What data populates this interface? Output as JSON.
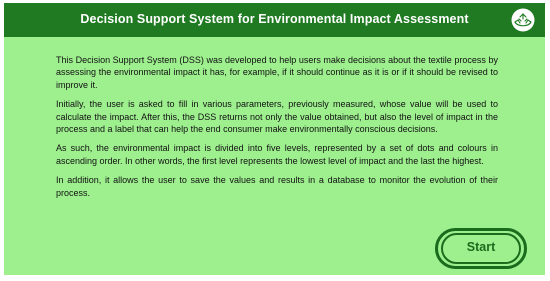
{
  "header": {
    "title": "Decision Support System for Environmental Impact Assessment",
    "logo_icon": "hands-recycle-icon",
    "background": "#1f7a22"
  },
  "content": {
    "paragraphs": [
      "This Decision Support System (DSS) was developed to help users make decisions about the textile process by assessing the environmental impact it has, for example, if it should continue as it is or if it should be revised to improve it.",
      "Initially, the user is asked to fill in various parameters, previously measured, whose value will be used to calculate the impact. After this, the DSS returns not only the value obtained, but also the level of impact in the process and a label that can help the end consumer make environmentally conscious decisions.",
      "As such, the environmental impact is divided into five levels, represented by a set of dots and colours in ascending order. In other words, the first level represents the lowest level of impact and the last the highest.",
      "In addition, it allows the user to save the values and results in a database to monitor the evolution of their process."
    ],
    "background": "#9ef08f"
  },
  "start_button": {
    "label": "Start",
    "color": "#1a6b1c"
  }
}
